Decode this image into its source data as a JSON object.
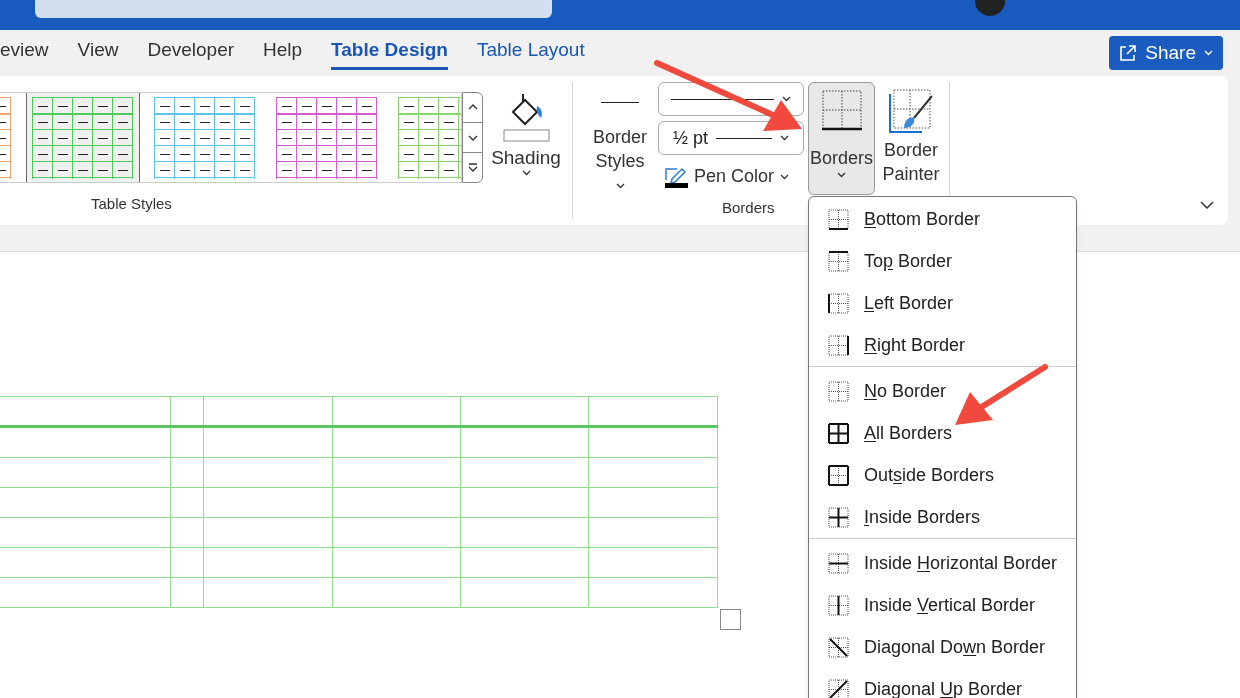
{
  "ribbon_tabs": [
    {
      "label": "eview",
      "kind": "standard",
      "selected": false
    },
    {
      "label": "View",
      "kind": "standard",
      "selected": false
    },
    {
      "label": "Developer",
      "kind": "standard",
      "selected": false
    },
    {
      "label": "Help",
      "kind": "standard",
      "selected": false
    },
    {
      "label": "Table Design",
      "kind": "contextual",
      "selected": true
    },
    {
      "label": "Table Layout",
      "kind": "contextual",
      "selected": false
    }
  ],
  "share_button": {
    "label": "Share"
  },
  "table_styles": {
    "group_label": "Table Styles",
    "styles": [
      {
        "color": "#f4a46c",
        "selected": false
      },
      {
        "color": "#4fc95a",
        "selected": true
      },
      {
        "color": "#5cc4ef",
        "selected": false
      },
      {
        "color": "#d45ed0",
        "selected": false
      },
      {
        "color": "#86d66a",
        "selected": false
      }
    ]
  },
  "shading": {
    "label": "Shading"
  },
  "borders_group": {
    "group_label": "Borders",
    "border_styles": "Border Styles",
    "pen_weight": "½ pt",
    "pen_color": "Pen Color",
    "borders_button": {
      "label": "Borders",
      "selected": true
    },
    "border_painter": "Border Painter"
  },
  "borders_menu": {
    "sections": [
      [
        {
          "key": "B",
          "after": "ottom Border",
          "kind": "bottom"
        },
        {
          "before": "To",
          "key": "p",
          "after": " Border",
          "kind": "top"
        },
        {
          "key": "L",
          "after": "eft Border",
          "kind": "left"
        },
        {
          "key": "R",
          "after": "ight Border",
          "kind": "right"
        }
      ],
      [
        {
          "key": "N",
          "after": "o Border",
          "kind": "none"
        },
        {
          "key": "A",
          "after": "ll Borders",
          "kind": "all"
        },
        {
          "before": "Out",
          "key": "s",
          "after": "ide Borders",
          "kind": "outside"
        },
        {
          "key": "I",
          "after": "nside Borders",
          "kind": "inside"
        }
      ],
      [
        {
          "before": "Inside ",
          "key": "H",
          "after": "orizontal Border",
          "kind": "inside_h"
        },
        {
          "before": "Inside ",
          "key": "V",
          "after": "ertical Border",
          "kind": "inside_v"
        },
        {
          "before": "Diagonal Do",
          "key": "w",
          "after": "n Border",
          "kind": "diag_down"
        },
        {
          "before": "Diagonal ",
          "key": "U",
          "after": "p Border",
          "kind": "diag_up"
        }
      ]
    ]
  }
}
